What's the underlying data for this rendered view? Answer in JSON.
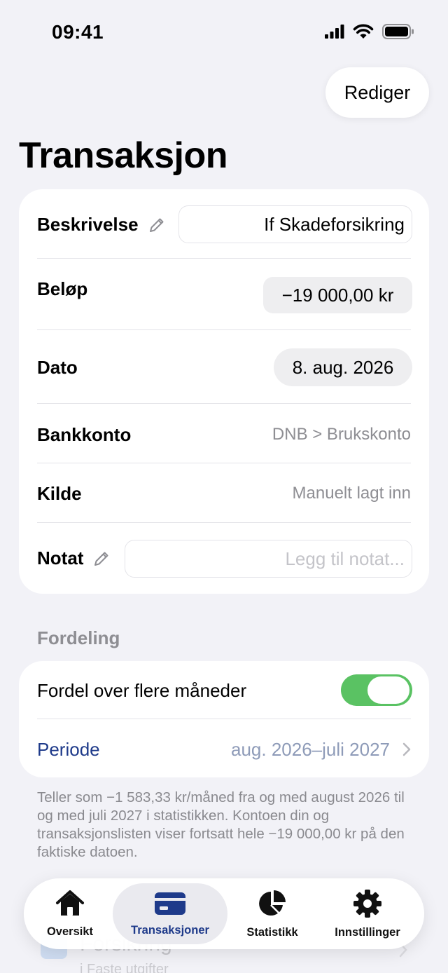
{
  "status_bar": {
    "time": "09:41"
  },
  "header": {
    "edit_label": "Rediger",
    "title": "Transaksjon"
  },
  "details": {
    "description": {
      "label": "Beskrivelse",
      "value": "If Skadeforsikring"
    },
    "amount": {
      "label": "Beløp",
      "value": "−19 000,00 kr"
    },
    "date": {
      "label": "Dato",
      "value": "8. aug. 2026"
    },
    "bank_account": {
      "label": "Bankkonto",
      "value": "DNB > Brukskonto"
    },
    "source": {
      "label": "Kilde",
      "value": "Manuelt lagt inn"
    },
    "note": {
      "label": "Notat",
      "placeholder": "Legg til notat..."
    }
  },
  "distribution": {
    "section_title": "Fordeling",
    "toggle_label": "Fordel over flere måneder",
    "toggle_on": true,
    "period_label": "Periode",
    "period_value": "aug. 2026–juli 2027",
    "footnote": "Teller som −1 583,33 kr/måned fra og med august 2026 til og med juli 2027 i statistikken. Kontoen din og transaksjonslisten viser fortsatt hele −19 000,00 kr på den faktiske datoen."
  },
  "background_item": {
    "category": "Forsikring",
    "subtitle": "i Faste utgifter"
  },
  "tabbar": {
    "tabs": [
      {
        "label": "Oversikt",
        "icon": "house-icon",
        "active": false
      },
      {
        "label": "Transaksjoner",
        "icon": "card-icon",
        "active": true
      },
      {
        "label": "Statistikk",
        "icon": "pie-chart-icon",
        "active": false
      },
      {
        "label": "Innstillinger",
        "icon": "gear-icon",
        "active": false
      }
    ]
  },
  "colors": {
    "accent": "#1e3a8a",
    "toggle_on": "#5ac263",
    "background": "#f2f2f7"
  }
}
